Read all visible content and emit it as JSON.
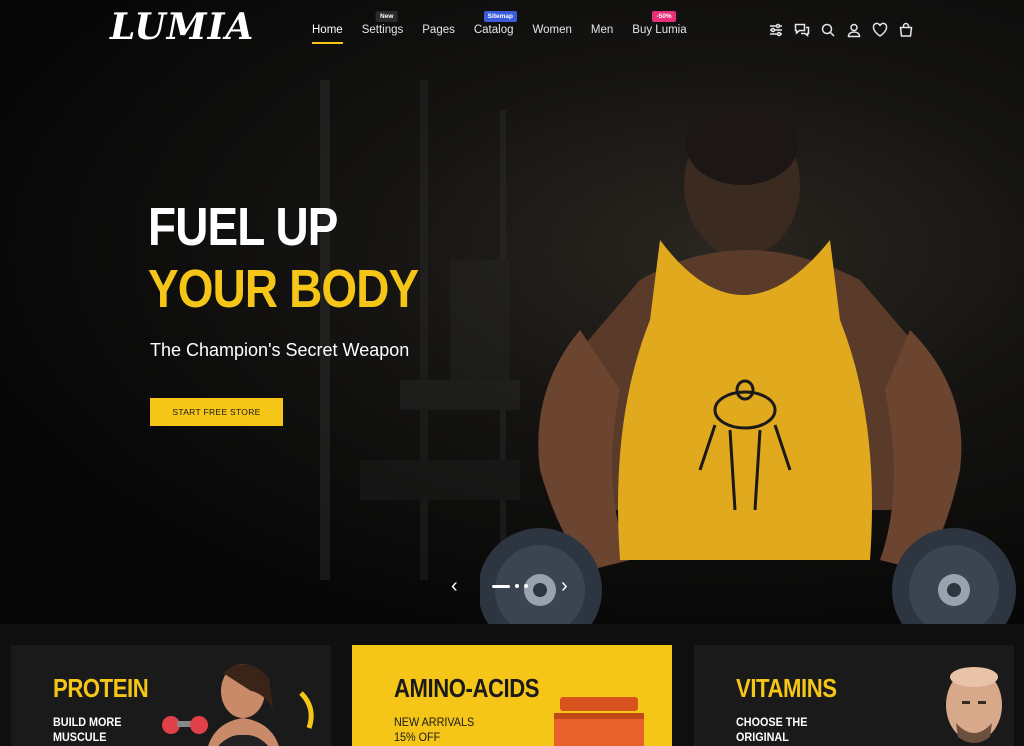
{
  "brand": {
    "logo": "LUMIA"
  },
  "nav": {
    "items": [
      {
        "label": "Home",
        "active": true
      },
      {
        "label": "Settings",
        "badge": "New",
        "badge_color": "#2b2b2b"
      },
      {
        "label": "Pages"
      },
      {
        "label": "Catalog",
        "badge": "Sitemap",
        "badge_color": "#3b5bdb"
      },
      {
        "label": "Women"
      },
      {
        "label": "Men"
      },
      {
        "label": "Buy Lumia",
        "badge": "-50%",
        "badge_color": "#e6317a"
      }
    ]
  },
  "header_icons": [
    "sliders-icon",
    "chat-icon",
    "search-icon",
    "user-icon",
    "heart-icon",
    "bag-icon"
  ],
  "hero": {
    "title_line1": "FUEL UP",
    "title_line2": "YOUR BODY",
    "subtitle": "The Champion's Secret Weapon",
    "cta": "START FREE STORE",
    "prev_arrow": "‹",
    "next_arrow": "›",
    "slide_count": 3,
    "active_slide": 1
  },
  "categories": [
    {
      "title": "PROTEIN",
      "subtitle": "BUILD MORE MUSCULE"
    },
    {
      "title": "AMINO-ACIDS",
      "subtitle": "NEW ARRIVALS 15% OFF"
    },
    {
      "title": "VITAMINS",
      "subtitle": "CHOOSE THE ORIGINAL"
    }
  ],
  "colors": {
    "accent": "#f5c518",
    "background": "#0b0b0b",
    "card_dark": "#1a1a1a"
  }
}
